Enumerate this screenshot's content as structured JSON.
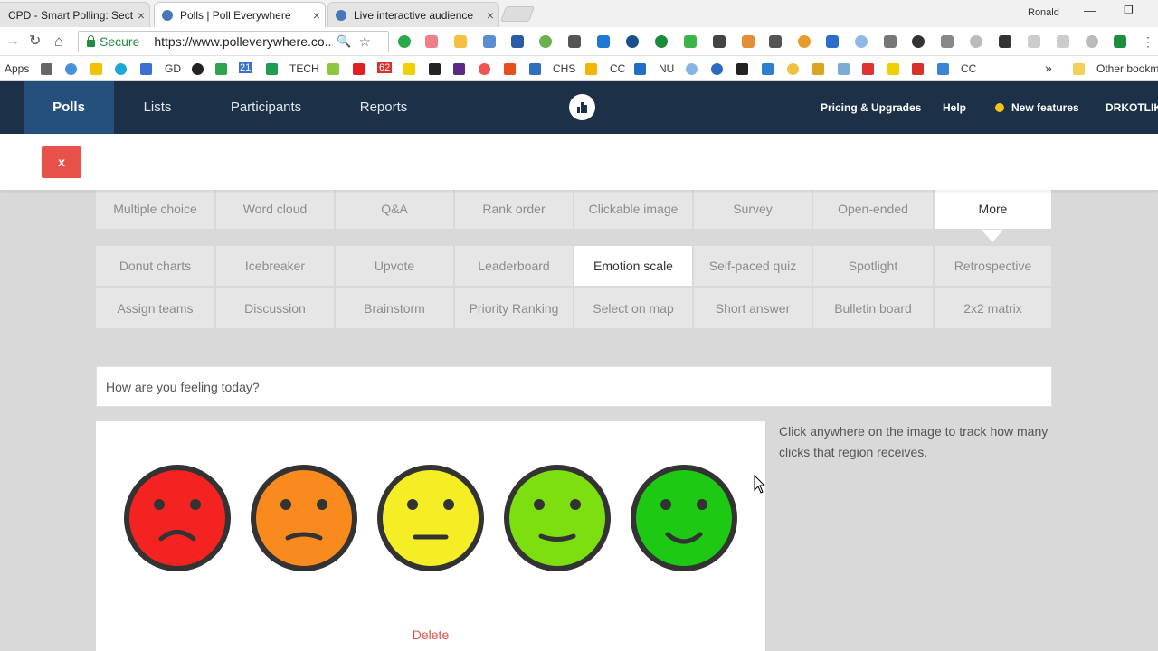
{
  "browser": {
    "tabs": [
      {
        "title": "CPD - Smart Polling: Sect"
      },
      {
        "title": "Polls | Poll Everywhere"
      },
      {
        "title": "Live interactive audience"
      }
    ],
    "user": "Ronald",
    "secure_label": "Secure",
    "url": "https://www.polleverywhere.co...",
    "bookmarks": [
      "Apps",
      "GD",
      "21",
      "TECH",
      "62",
      "CHS",
      "CC",
      "NU",
      "CC"
    ],
    "other_bookmarks": "Other bookm",
    "overflow": "»"
  },
  "nav": {
    "items": [
      "Polls",
      "Lists",
      "Participants",
      "Reports"
    ],
    "right": {
      "pricing": "Pricing & Upgrades",
      "help": "Help",
      "new_features": "New features",
      "account": "DRKOTLIK"
    }
  },
  "close_label": "x",
  "activity_types": {
    "row1": [
      "Multiple choice",
      "Word cloud",
      "Q&A",
      "Rank order",
      "Clickable image",
      "Survey",
      "Open-ended",
      "More"
    ],
    "row2": [
      "Donut charts",
      "Icebreaker",
      "Upvote",
      "Leaderboard",
      "Emotion scale",
      "Self-paced quiz",
      "Spotlight",
      "Retrospective"
    ],
    "row3": [
      "Assign teams",
      "Discussion",
      "Brainstorm",
      "Priority Ranking",
      "Select on map",
      "Short answer",
      "Bulletin board",
      "2x2 matrix"
    ],
    "selected_tab": "More",
    "selected_type": "Emotion scale"
  },
  "question": {
    "value": "How are you feeling today?"
  },
  "image": {
    "faces": [
      {
        "mood": "very-sad",
        "color": "#f52222"
      },
      {
        "mood": "sad",
        "color": "#f98a1e"
      },
      {
        "mood": "neutral",
        "color": "#f5ee25"
      },
      {
        "mood": "happy",
        "color": "#7ddf10"
      },
      {
        "mood": "very-happy",
        "color": "#1dc912"
      }
    ],
    "delete_label": "Delete"
  },
  "hint": "Click anywhere on the image to track how many clicks that region receives."
}
